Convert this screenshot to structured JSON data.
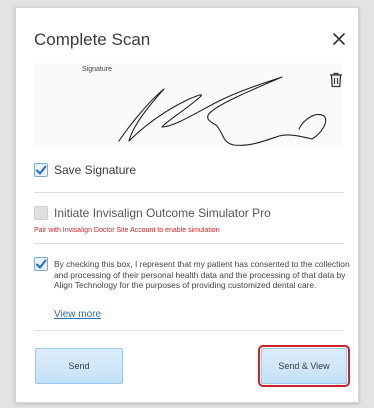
{
  "dialog": {
    "title": "Complete Scan",
    "signature_label": "Signature",
    "save_signature_label": "Save Signature",
    "simulator_label": "Initiate Invisalign Outcome Simulator Pro",
    "simulator_warning": "Pair with Invisalign Doctor Site Account to enable simulation",
    "consent_text": "By checking this box, I represent that my patient has consented to the collection and processing of their personal health data and the processing of that data by Align Technology for the purposes of providing customized dental care.",
    "view_more_label": "View more",
    "send_label": "Send",
    "send_view_label": "Send & View"
  },
  "state": {
    "save_signature_checked": true,
    "simulator_checked": false,
    "simulator_enabled": false,
    "consent_checked": true
  },
  "colors": {
    "accent": "#2a6fb5",
    "warning": "#d02020",
    "button_bg": "#c4e1f7",
    "highlight": "#c8232c"
  },
  "icons": {
    "close": "close-icon",
    "trash": "trash-icon",
    "checkmark": "checkmark-icon"
  }
}
